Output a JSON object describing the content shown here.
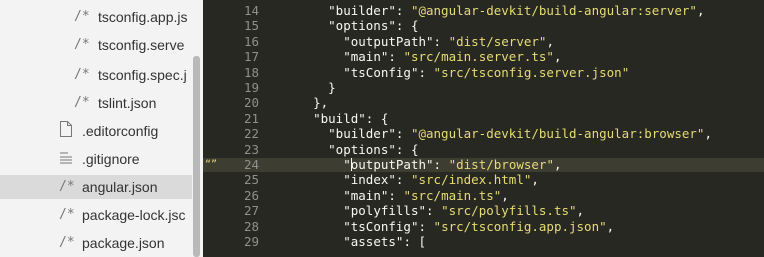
{
  "sidebar": {
    "items": [
      {
        "icon": "/*",
        "icon_name": "comment-file-icon",
        "label": "tsconfig.app.js",
        "indent": "deep"
      },
      {
        "icon": "/*",
        "icon_name": "comment-file-icon",
        "label": "tsconfig.serve",
        "indent": "deep"
      },
      {
        "icon": "/*",
        "icon_name": "comment-file-icon",
        "label": "tsconfig.spec.j",
        "indent": "deep"
      },
      {
        "icon": "/*",
        "icon_name": "comment-file-icon",
        "label": "tslint.json",
        "indent": "deep"
      },
      {
        "icon": "",
        "icon_name": "blank-file-icon",
        "label": ".editorconfig",
        "indent": "root"
      },
      {
        "icon": "",
        "icon_name": "text-file-icon",
        "label": ".gitignore",
        "indent": "root"
      },
      {
        "icon": "/*",
        "icon_name": "comment-file-icon",
        "label": "angular.json",
        "indent": "root",
        "active": true
      },
      {
        "icon": "/*",
        "icon_name": "comment-file-icon",
        "label": "package-lock.jsc",
        "indent": "root"
      },
      {
        "icon": "/*",
        "icon_name": "comment-file-icon",
        "label": "package.json",
        "indent": "root"
      }
    ]
  },
  "editor": {
    "gutter_marker": "“”",
    "lines": [
      {
        "num": "14",
        "text": "      \"builder\": \"@angular-devkit/build-angular:server\","
      },
      {
        "num": "15",
        "text": "      \"options\": {"
      },
      {
        "num": "16",
        "text": "        \"outputPath\": \"dist/server\","
      },
      {
        "num": "17",
        "text": "        \"main\": \"src/main.server.ts\","
      },
      {
        "num": "18",
        "text": "        \"tsConfig\": \"src/tsconfig.server.json\""
      },
      {
        "num": "19",
        "text": "      }"
      },
      {
        "num": "20",
        "text": "    },"
      },
      {
        "num": "21",
        "text": "    \"build\": {"
      },
      {
        "num": "22",
        "text": "      \"builder\": \"@angular-devkit/build-angular:browser\","
      },
      {
        "num": "23",
        "text": "      \"options\": {"
      },
      {
        "num": "24",
        "text": "        \"outputPath\": \"dist/browser\",",
        "current": true
      },
      {
        "num": "25",
        "text": "        \"index\": \"src/index.html\","
      },
      {
        "num": "26",
        "text": "        \"main\": \"src/main.ts\","
      },
      {
        "num": "27",
        "text": "        \"polyfills\": \"src/polyfills.ts\","
      },
      {
        "num": "28",
        "text": "        \"tsConfig\": \"src/tsconfig.app.json\","
      },
      {
        "num": "29",
        "text": "        \"assets\": ["
      }
    ]
  },
  "colors": {
    "editor_bg": "#272822",
    "string": "#e6db74",
    "line_number": "#8f908a",
    "sidebar_bg": "#f3f3f3",
    "sidebar_active": "#dadada"
  }
}
